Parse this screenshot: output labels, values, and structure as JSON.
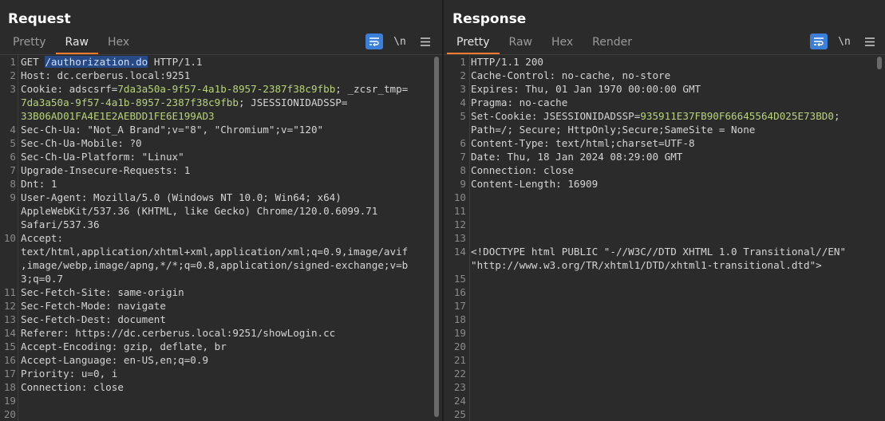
{
  "request": {
    "title": "Request",
    "tabs": [
      "Pretty",
      "Raw",
      "Hex"
    ],
    "active_tab": "Raw",
    "tools": {
      "wrap_icon": "wrap-lines-icon",
      "newline_label": "\\n",
      "menu_icon": "menu-icon"
    },
    "lines": [
      {
        "n": "1",
        "parts": [
          [
            "k",
            "GET "
          ],
          [
            "hl",
            "/authorization.do"
          ],
          [
            "k",
            " HTTP/1.1"
          ]
        ]
      },
      {
        "n": "2",
        "parts": [
          [
            "k",
            "Host: dc.cerberus.local:9251"
          ]
        ]
      },
      {
        "n": "3",
        "parts": [
          [
            "k",
            "Cookie: adscsrf="
          ],
          [
            "v",
            "7da3a50a-9f57-4a1b-8957-2387f38c9fbb"
          ],
          [
            "k",
            "; _zcsr_tmp="
          ]
        ]
      },
      {
        "n": "",
        "parts": [
          [
            "v",
            "7da3a50a-9f57-4a1b-8957-2387f38c9fbb"
          ],
          [
            "k",
            "; JSESSIONIDADSSP="
          ]
        ]
      },
      {
        "n": "",
        "parts": [
          [
            "v",
            "33B06AD01FA4E1E2AEBDD1FE6E199AD3"
          ]
        ]
      },
      {
        "n": "4",
        "parts": [
          [
            "k",
            "Sec-Ch-Ua: \"Not_A Brand\";v=\"8\", \"Chromium\";v=\"120\""
          ]
        ]
      },
      {
        "n": "5",
        "parts": [
          [
            "k",
            "Sec-Ch-Ua-Mobile: ?0"
          ]
        ]
      },
      {
        "n": "6",
        "parts": [
          [
            "k",
            "Sec-Ch-Ua-Platform: \"Linux\""
          ]
        ]
      },
      {
        "n": "7",
        "parts": [
          [
            "k",
            "Upgrade-Insecure-Requests: 1"
          ]
        ]
      },
      {
        "n": "8",
        "parts": [
          [
            "k",
            "Dnt: 1"
          ]
        ]
      },
      {
        "n": "9",
        "parts": [
          [
            "k",
            "User-Agent: Mozilla/5.0 (Windows NT 10.0; Win64; x64)"
          ]
        ]
      },
      {
        "n": "",
        "parts": [
          [
            "k",
            "AppleWebKit/537.36 (KHTML, like Gecko) Chrome/120.0.6099.71"
          ]
        ]
      },
      {
        "n": "",
        "parts": [
          [
            "k",
            "Safari/537.36"
          ]
        ]
      },
      {
        "n": "10",
        "parts": [
          [
            "k",
            "Accept:"
          ]
        ]
      },
      {
        "n": "",
        "parts": [
          [
            "k",
            "text/html,application/xhtml+xml,application/xml;q=0.9,image/avif"
          ]
        ]
      },
      {
        "n": "",
        "parts": [
          [
            "k",
            ",image/webp,image/apng,*/*;q=0.8,application/signed-exchange;v=b"
          ]
        ]
      },
      {
        "n": "",
        "parts": [
          [
            "k",
            "3;q=0.7"
          ]
        ]
      },
      {
        "n": "11",
        "parts": [
          [
            "k",
            "Sec-Fetch-Site: same-origin"
          ]
        ]
      },
      {
        "n": "12",
        "parts": [
          [
            "k",
            "Sec-Fetch-Mode: navigate"
          ]
        ]
      },
      {
        "n": "13",
        "parts": [
          [
            "k",
            "Sec-Fetch-Dest: document"
          ]
        ]
      },
      {
        "n": "14",
        "parts": [
          [
            "k",
            "Referer: https://dc.cerberus.local:9251/showLogin.cc"
          ]
        ]
      },
      {
        "n": "15",
        "parts": [
          [
            "k",
            "Accept-Encoding: gzip, deflate, br"
          ]
        ]
      },
      {
        "n": "16",
        "parts": [
          [
            "k",
            "Accept-Language: en-US,en;q=0.9"
          ]
        ]
      },
      {
        "n": "17",
        "parts": [
          [
            "k",
            "Priority: u=0, i"
          ]
        ]
      },
      {
        "n": "18",
        "parts": [
          [
            "k",
            "Connection: close"
          ]
        ]
      },
      {
        "n": "19",
        "parts": [
          [
            "k",
            ""
          ]
        ]
      },
      {
        "n": "20",
        "parts": [
          [
            "k",
            ""
          ]
        ]
      }
    ]
  },
  "response": {
    "title": "Response",
    "tabs": [
      "Pretty",
      "Raw",
      "Hex",
      "Render"
    ],
    "active_tab": "Pretty",
    "tools": {
      "wrap_icon": "wrap-lines-icon",
      "newline_label": "\\n",
      "menu_icon": "menu-icon"
    },
    "lines": [
      {
        "n": "1",
        "parts": [
          [
            "k",
            "HTTP/1.1 200"
          ]
        ]
      },
      {
        "n": "2",
        "parts": [
          [
            "k",
            "Cache-Control: no-cache, no-store"
          ]
        ]
      },
      {
        "n": "3",
        "parts": [
          [
            "k",
            "Expires: Thu, 01 Jan 1970 00:00:00 GMT"
          ]
        ]
      },
      {
        "n": "4",
        "parts": [
          [
            "k",
            "Pragma: no-cache"
          ]
        ]
      },
      {
        "n": "5",
        "parts": [
          [
            "k",
            "Set-Cookie: JSESSIONIDADSSP="
          ],
          [
            "v",
            "935911E37FB90F66645564D025E73BD0"
          ],
          [
            "k",
            ";"
          ]
        ]
      },
      {
        "n": "",
        "parts": [
          [
            "k",
            "Path=/; Secure; HttpOnly;Secure;SameSite = None"
          ]
        ]
      },
      {
        "n": "6",
        "parts": [
          [
            "k",
            "Content-Type: text/html;charset=UTF-8"
          ]
        ]
      },
      {
        "n": "7",
        "parts": [
          [
            "k",
            "Date: Thu, 18 Jan 2024 08:29:00 GMT"
          ]
        ]
      },
      {
        "n": "8",
        "parts": [
          [
            "k",
            "Connection: close"
          ]
        ]
      },
      {
        "n": "9",
        "parts": [
          [
            "k",
            "Content-Length: 16909"
          ]
        ]
      },
      {
        "n": "10",
        "parts": [
          [
            "k",
            ""
          ]
        ]
      },
      {
        "n": "11",
        "parts": [
          [
            "k",
            ""
          ]
        ]
      },
      {
        "n": "12",
        "parts": [
          [
            "k",
            ""
          ]
        ]
      },
      {
        "n": "13",
        "parts": [
          [
            "k",
            ""
          ]
        ]
      },
      {
        "n": "14",
        "parts": [
          [
            "k",
            "<!DOCTYPE html PUBLIC \"-//W3C//DTD XHTML 1.0 Transitional//EN\""
          ]
        ]
      },
      {
        "n": "",
        "parts": [
          [
            "k",
            "\"http://www.w3.org/TR/xhtml1/DTD/xhtml1-transitional.dtd\">"
          ]
        ]
      },
      {
        "n": "15",
        "parts": [
          [
            "k",
            ""
          ]
        ]
      },
      {
        "n": "16",
        "parts": [
          [
            "k",
            ""
          ]
        ]
      },
      {
        "n": "17",
        "parts": [
          [
            "k",
            ""
          ]
        ]
      },
      {
        "n": "18",
        "parts": [
          [
            "k",
            ""
          ]
        ]
      },
      {
        "n": "19",
        "parts": [
          [
            "k",
            ""
          ]
        ]
      },
      {
        "n": "20",
        "parts": [
          [
            "k",
            ""
          ]
        ]
      },
      {
        "n": "21",
        "parts": [
          [
            "k",
            ""
          ]
        ]
      },
      {
        "n": "22",
        "parts": [
          [
            "k",
            ""
          ]
        ]
      },
      {
        "n": "23",
        "parts": [
          [
            "k",
            ""
          ]
        ]
      },
      {
        "n": "24",
        "parts": [
          [
            "k",
            ""
          ]
        ]
      },
      {
        "n": "25",
        "parts": [
          [
            "k",
            ""
          ]
        ]
      }
    ]
  },
  "layout_toggle": {
    "icons": [
      "split-vertical-icon",
      "split-horizontal-icon",
      "single-pane-icon"
    ],
    "active": 0
  },
  "colors": {
    "accent": "#ff7b2e",
    "highlight": "#274a86",
    "value": "#b9d27a",
    "button": "#3b7fd8"
  }
}
